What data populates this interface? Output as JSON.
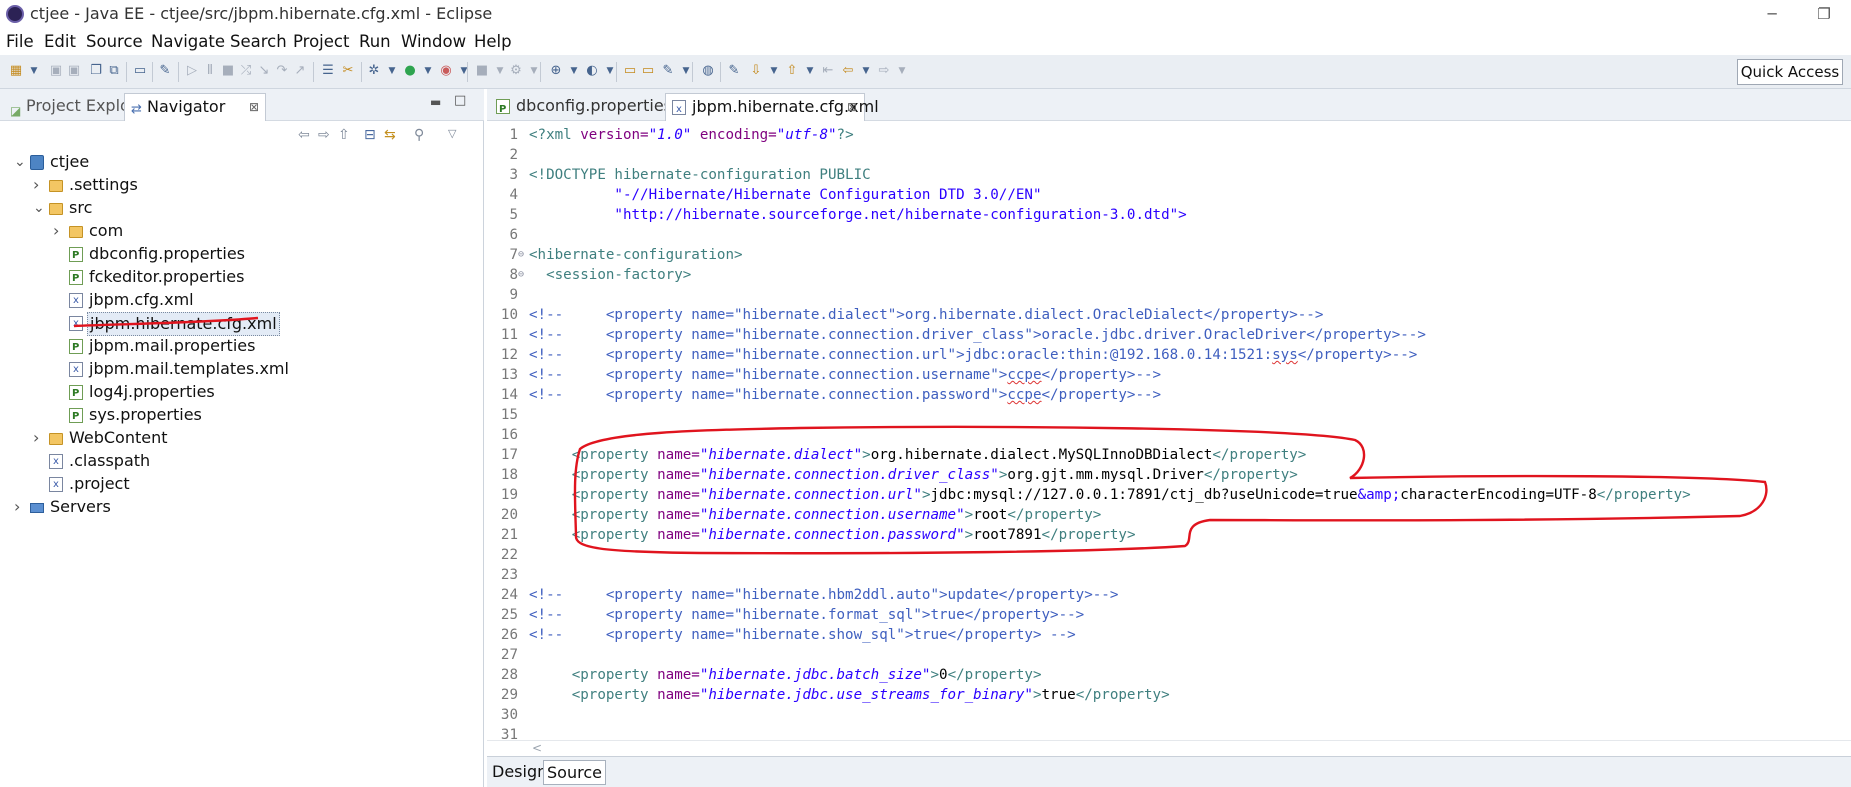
{
  "window": {
    "title": "ctjee - Java EE - ctjee/src/jbpm.hibernate.cfg.xml - Eclipse"
  },
  "menu": [
    "File",
    "Edit",
    "Source",
    "Navigate",
    "Search",
    "Project",
    "Run",
    "Window",
    "Help"
  ],
  "toolbar": {
    "quick_access": "Quick Access"
  },
  "left_panel": {
    "tabs": [
      {
        "label": "Project Explorer",
        "active": false
      },
      {
        "label": "Navigator",
        "active": true
      }
    ],
    "tree": [
      {
        "label": "ctjee",
        "icon": "project-icon",
        "expanded": true
      },
      {
        "label": ".settings",
        "icon": "folder-icon"
      },
      {
        "label": "src",
        "icon": "folder-icon",
        "expanded": true
      },
      {
        "label": "com",
        "icon": "folder-icon"
      },
      {
        "label": "dbconfig.properties",
        "icon": "properties-file-icon"
      },
      {
        "label": "fckeditor.properties",
        "icon": "properties-file-icon"
      },
      {
        "label": "jbpm.cfg.xml",
        "icon": "xml-file-icon"
      },
      {
        "label": "jbpm.hibernate.cfg.xml",
        "icon": "xml-file-icon",
        "selected": true
      },
      {
        "label": "jbpm.mail.properties",
        "icon": "properties-file-icon"
      },
      {
        "label": "jbpm.mail.templates.xml",
        "icon": "xml-file-icon"
      },
      {
        "label": "log4j.properties",
        "icon": "properties-file-icon"
      },
      {
        "label": "sys.properties",
        "icon": "properties-file-icon"
      },
      {
        "label": "WebContent",
        "icon": "folder-icon"
      },
      {
        "label": ".classpath",
        "icon": "xml-file-icon"
      },
      {
        "label": ".project",
        "icon": "xml-file-icon"
      },
      {
        "label": "Servers",
        "icon": "server-folder-icon"
      }
    ]
  },
  "editor": {
    "tabs": [
      {
        "label": "dbconfig.properties",
        "active": false
      },
      {
        "label": "jbpm.hibernate.cfg.xml",
        "active": true,
        "close": "⊠"
      }
    ],
    "bottom_tabs": [
      {
        "label": "Design",
        "active": false
      },
      {
        "label": "Source",
        "active": true
      }
    ],
    "lines": [
      {
        "n": "1",
        "p": [
          {
            "t": "<?xml ",
            "c": "tag"
          },
          {
            "t": "version=",
            "c": "an"
          },
          {
            "t": "\"1.0\"",
            "c": "av"
          },
          {
            "t": " encoding=",
            "c": "an"
          },
          {
            "t": "\"utf-8\"",
            "c": "av"
          },
          {
            "t": "?>",
            "c": "tag"
          }
        ]
      },
      {
        "n": "2",
        "p": []
      },
      {
        "n": "3",
        "p": [
          {
            "t": "<!DOCTYPE ",
            "c": "tag"
          },
          {
            "t": "hibernate-configuration ",
            "c": "tag"
          },
          {
            "t": "PUBLIC",
            "c": "tag"
          }
        ]
      },
      {
        "n": "4",
        "p": [
          {
            "t": "          \"-//Hibernate/Hibernate Configuration DTD 3.0//EN\"",
            "c": "av2"
          }
        ]
      },
      {
        "n": "5",
        "p": [
          {
            "t": "          \"http://hibernate.sourceforge.net/hibernate-configuration-3.0.dtd\">",
            "c": "av2"
          }
        ]
      },
      {
        "n": "6",
        "p": []
      },
      {
        "n": "7",
        "fold": "⊖",
        "p": [
          {
            "t": "<hibernate-configuration>",
            "c": "tag"
          }
        ]
      },
      {
        "n": "8",
        "fold": "⊖",
        "p": [
          {
            "t": "  <session-factory>",
            "c": "tag"
          }
        ]
      },
      {
        "n": "9",
        "p": []
      },
      {
        "n": "10",
        "p": [
          {
            "t": "<!--     <property name=\"hibernate.dialect\">org.hibernate.dialect.OracleDialect</property>-->",
            "c": "cm"
          }
        ]
      },
      {
        "n": "11",
        "p": [
          {
            "t": "<!--     <property name=\"hibernate.connection.driver_class\">oracle.jdbc.driver.OracleDriver</property>-->",
            "c": "cm"
          }
        ]
      },
      {
        "n": "12",
        "p": [
          {
            "t": "<!--     <property name=\"hibernate.connection.url\">jdbc:oracle:thin:@192.168.0.14:1521:",
            "c": "cm"
          },
          {
            "t": "sys",
            "c": "cm squig"
          },
          {
            "t": "</property>-->",
            "c": "cm"
          }
        ]
      },
      {
        "n": "13",
        "p": [
          {
            "t": "<!--     <property name=\"hibernate.connection.username\">",
            "c": "cm"
          },
          {
            "t": "ccpe",
            "c": "cm squig"
          },
          {
            "t": "</property>-->",
            "c": "cm"
          }
        ]
      },
      {
        "n": "14",
        "p": [
          {
            "t": "<!--     <property name=\"hibernate.connection.password\">",
            "c": "cm"
          },
          {
            "t": "ccpe",
            "c": "cm squig"
          },
          {
            "t": "</property>-->",
            "c": "cm"
          }
        ]
      },
      {
        "n": "15",
        "p": []
      },
      {
        "n": "16",
        "p": []
      },
      {
        "n": "17",
        "p": [
          {
            "t": "     <property ",
            "c": "tag"
          },
          {
            "t": "name=",
            "c": "an"
          },
          {
            "t": "\"hibernate.dialect\"",
            "c": "av"
          },
          {
            "t": ">",
            "c": "tag"
          },
          {
            "t": "org.hibernate.dialect.MySQLInnoDBDialect",
            "c": "pt"
          },
          {
            "t": "</property>",
            "c": "tag"
          }
        ]
      },
      {
        "n": "18",
        "p": [
          {
            "t": "     <property ",
            "c": "tag"
          },
          {
            "t": "name=",
            "c": "an"
          },
          {
            "t": "\"hibernate.connection.driver_class\"",
            "c": "av"
          },
          {
            "t": ">",
            "c": "tag"
          },
          {
            "t": "org.gjt.mm.mysql.Driver",
            "c": "pt"
          },
          {
            "t": "</property>",
            "c": "tag"
          }
        ]
      },
      {
        "n": "19",
        "p": [
          {
            "t": "     <property ",
            "c": "tag"
          },
          {
            "t": "name=",
            "c": "an"
          },
          {
            "t": "\"hibernate.connection.url\"",
            "c": "av"
          },
          {
            "t": ">",
            "c": "tag"
          },
          {
            "t": "jdbc:mysql://127.0.0.1:7891/ctj_db?useUnicode=true",
            "c": "pt"
          },
          {
            "t": "&amp;",
            "c": "ent"
          },
          {
            "t": "characterEncoding=UTF-8",
            "c": "pt"
          },
          {
            "t": "</property>",
            "c": "tag"
          }
        ]
      },
      {
        "n": "20",
        "p": [
          {
            "t": "     <property ",
            "c": "tag"
          },
          {
            "t": "name=",
            "c": "an"
          },
          {
            "t": "\"hibernate.connection.username\"",
            "c": "av"
          },
          {
            "t": ">",
            "c": "tag"
          },
          {
            "t": "root",
            "c": "pt"
          },
          {
            "t": "</property>",
            "c": "tag"
          }
        ]
      },
      {
        "n": "21",
        "p": [
          {
            "t": "     <property ",
            "c": "tag"
          },
          {
            "t": "name=",
            "c": "an"
          },
          {
            "t": "\"hibernate.connection.password\"",
            "c": "av"
          },
          {
            "t": ">",
            "c": "tag"
          },
          {
            "t": "root7891",
            "c": "pt"
          },
          {
            "t": "</property>",
            "c": "tag"
          }
        ]
      },
      {
        "n": "22",
        "p": []
      },
      {
        "n": "23",
        "p": []
      },
      {
        "n": "24",
        "p": [
          {
            "t": "<!--     <property name=\"hibernate.hbm2ddl.auto\">update</property>-->",
            "c": "cm"
          }
        ]
      },
      {
        "n": "25",
        "p": [
          {
            "t": "<!--     <property name=\"hibernate.format_sql\">true</property>-->",
            "c": "cm"
          }
        ]
      },
      {
        "n": "26",
        "p": [
          {
            "t": "<!--     <property name=\"hibernate.show_sql\">true</property> -->",
            "c": "cm"
          }
        ]
      },
      {
        "n": "27",
        "p": []
      },
      {
        "n": "28",
        "p": [
          {
            "t": "     <property ",
            "c": "tag"
          },
          {
            "t": "name=",
            "c": "an"
          },
          {
            "t": "\"hibernate.jdbc.batch_size\"",
            "c": "av"
          },
          {
            "t": ">",
            "c": "tag"
          },
          {
            "t": "0",
            "c": "pt"
          },
          {
            "t": "</property>",
            "c": "tag"
          }
        ]
      },
      {
        "n": "29",
        "p": [
          {
            "t": "     <property ",
            "c": "tag"
          },
          {
            "t": "name=",
            "c": "an"
          },
          {
            "t": "\"hibernate.jdbc.use_streams_for_binary\"",
            "c": "av"
          },
          {
            "t": ">",
            "c": "tag"
          },
          {
            "t": "true",
            "c": "pt"
          },
          {
            "t": "</property>",
            "c": "tag"
          }
        ]
      },
      {
        "n": "30",
        "p": []
      },
      {
        "n": "31",
        "p": []
      }
    ]
  },
  "colors": {
    "annotation": "#e0141e",
    "tag": "#3f7f7f",
    "attr": "#7f007f",
    "value": "#2a00ff",
    "comment": "#3f5fbf"
  }
}
